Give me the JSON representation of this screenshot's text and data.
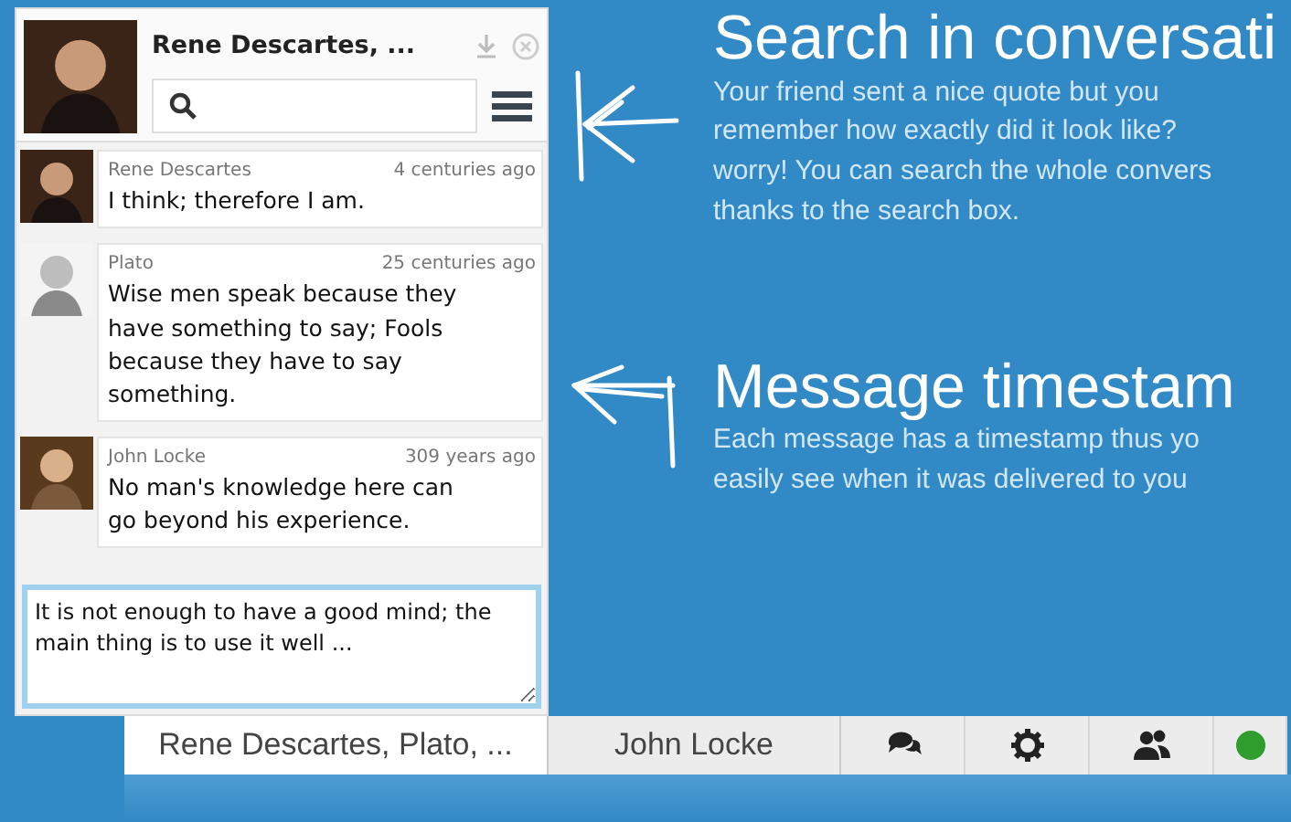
{
  "chat_window": {
    "title": "Rene Descartes, ...",
    "messages": [
      {
        "author": "Rene Descartes",
        "time": "4 centuries ago",
        "text": "I think; therefore I am."
      },
      {
        "author": "Plato",
        "time": "25 centuries ago",
        "text": "Wise men speak because they have something to say; Fools because they have to say something."
      },
      {
        "author": "John Locke",
        "time": "309 years ago",
        "text": "No man's knowledge here can go beyond his experience."
      }
    ],
    "composer": {
      "value": "It is not enough to have a good mind; the main thing is to use it well ..."
    }
  },
  "features": [
    {
      "title": "Search in conversati",
      "lines": [
        "Your friend sent a nice quote but you",
        "remember how exactly did it look like?",
        "worry! You can search the whole convers",
        "thanks to the search box."
      ]
    },
    {
      "title": "Message timestam",
      "lines": [
        "Each message has a timestamp thus yo",
        "easily see when it was delivered to you"
      ]
    }
  ],
  "taskbar": {
    "tabs": [
      {
        "label": "Rene Descartes, Plato, ...",
        "selected": true
      },
      {
        "label": "John Locke",
        "selected": false
      }
    ],
    "status": {
      "color": "#2f9e2f"
    }
  }
}
